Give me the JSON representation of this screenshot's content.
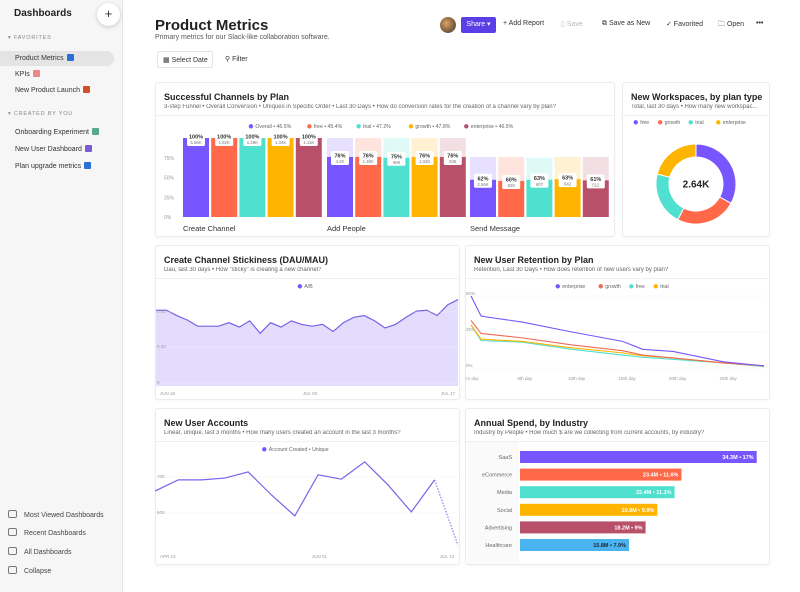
{
  "sidebar": {
    "title": "Dashboards",
    "add_label": "+",
    "favorites_label": "FAVORITES",
    "created_label": "CREATED BY YOU",
    "favorites": [
      {
        "label": "Product Metrics",
        "icon": "blue-square-emoji",
        "color": "#2a6fd6",
        "active": true
      },
      {
        "label": "KPIs",
        "icon": "chart-emoji",
        "color": "#e88"
      },
      {
        "label": "New Product Launch",
        "icon": "sparkle-emoji",
        "color": "#d0502c"
      }
    ],
    "created": [
      {
        "label": "Onboarding Experiment",
        "icon": "pencil-emoji",
        "color": "#5a8"
      },
      {
        "label": "New User Dashboard",
        "icon": "purple-circle-emoji",
        "color": "#7b5ad6"
      },
      {
        "label": "Plan upgrade metrics",
        "icon": "info-emoji",
        "color": "#2a6fd6"
      }
    ],
    "bottom": [
      {
        "label": "Most Viewed Dashboards",
        "icon": "clock-icon"
      },
      {
        "label": "Recent Dashboards",
        "icon": "calendar-icon"
      },
      {
        "label": "All Dashboards",
        "icon": "folder-icon"
      },
      {
        "label": "Collapse",
        "icon": "collapse-icon"
      }
    ]
  },
  "header": {
    "title": "Product Metrics",
    "subtitle": "Primary metrics for our Slack-like collaboration software.",
    "share": "Share ▾",
    "add_report": "+ Add Report",
    "save": "Save",
    "save_as_new": "Save as New",
    "favorited": "✓ Favorited",
    "open": "Open",
    "more": "•••",
    "select_date": "Select Date",
    "filter": "Filter"
  },
  "colors": {
    "purple": "#7856ff",
    "orange": "#ff6848",
    "teal": "#4fe0d0",
    "yellow": "#ffb400",
    "maroon": "#b8506a",
    "blue": "#4ab4f0",
    "accent": "#5b3fe6"
  },
  "chart_data": [
    {
      "id": "funnel",
      "type": "bar",
      "title": "Successful Channels by Plan",
      "subtitle": "3-step Funnel • Overall Conversion • Uniques in Specific Order • Last 30 Days • How do conversion rates for the creation of a channel vary by plan?",
      "legend": [
        "Overall • 46.5%",
        "free • 45.4%",
        "trial • 47.2%",
        "growth • 47.8%",
        "enterprise • 46.5%"
      ],
      "yticks": [
        "0%",
        "25%",
        "50%",
        "75%"
      ],
      "ylim": [
        0,
        100
      ],
      "steps": [
        {
          "name": "Create Channel",
          "pct": [
            100,
            100,
            100,
            100,
            100
          ],
          "counts": [
            "5.56K",
            "1.82K",
            "1.28K",
            "1.34K",
            "1.11K"
          ]
        },
        {
          "name": "Add People",
          "pct": [
            76,
            76,
            75,
            76,
            76
          ],
          "counts": [
            "4.2K",
            "1.38K",
            "959",
            "1.02K",
            "845"
          ]
        },
        {
          "name": "Send Message",
          "pct": [
            62,
            60,
            63,
            63,
            61
          ],
          "counts": [
            "2.56K",
            "828",
            "607",
            "642",
            "512"
          ]
        }
      ]
    },
    {
      "id": "donut",
      "type": "pie",
      "title": "New Workspaces, by plan type",
      "subtitle": "Total, last 30 days • How many new workspac...",
      "legend": [
        "free",
        "growth",
        "trial",
        "enterprise"
      ],
      "values": [
        33,
        24.5,
        21.5,
        21
      ],
      "center": "2.64K"
    },
    {
      "id": "stickiness",
      "type": "area",
      "title": "Create Channel Stickiness (DAU/MAU)",
      "subtitle": "Dau, last 30 days • How \"sticky\" is creating a new channel?",
      "legend": [
        "A/B"
      ],
      "yticks": [
        "0",
        "0.20",
        "0.40"
      ],
      "ylim": [
        0,
        0.6
      ],
      "xticks": [
        "JUN 18",
        "JUL 03",
        "JUL 17"
      ],
      "values": [
        0.41,
        0.41,
        0.38,
        0.355,
        0.32,
        0.32,
        0.32,
        0.34,
        0.315,
        0.35,
        0.28,
        0.34,
        0.315,
        0.35,
        0.33,
        0.32,
        0.33,
        0.29,
        0.34,
        0.37,
        0.38,
        0.35,
        0.31,
        0.33,
        0.37,
        0.405,
        0.41,
        0.38,
        0.44,
        0.47
      ]
    },
    {
      "id": "retention",
      "type": "line",
      "title": "New User Retention by Plan",
      "subtitle": "Retention, Last 30 Days • How does retention of new users vary by plan?",
      "legend": [
        "enterprise",
        "growth",
        "free",
        "trial"
      ],
      "yticks": [
        "0%",
        "25%",
        "50%"
      ],
      "ylim": [
        0,
        50
      ],
      "xticks": [
        "<1 day",
        "5th day",
        "10th day",
        "15th day",
        "20th day",
        "25th day"
      ],
      "series": [
        {
          "name": "enterprise",
          "points": [
            [
              0,
              50
            ],
            [
              1,
              36
            ],
            [
              5,
              32
            ],
            [
              10,
              25
            ],
            [
              15,
              18.5
            ],
            [
              17,
              13
            ],
            [
              20,
              11.5
            ],
            [
              25,
              4.3
            ],
            [
              29,
              1.5
            ]
          ]
        },
        {
          "name": "growth",
          "points": [
            [
              0,
              33
            ],
            [
              1,
              24
            ],
            [
              5,
              21
            ],
            [
              10,
              16
            ],
            [
              15,
              12
            ],
            [
              17,
              9
            ],
            [
              20,
              7
            ],
            [
              25,
              3.5
            ],
            [
              29,
              1.5
            ]
          ]
        },
        {
          "name": "free",
          "points": [
            [
              0,
              30
            ],
            [
              1,
              19
            ],
            [
              5,
              18
            ],
            [
              10,
              13
            ],
            [
              15,
              9
            ],
            [
              17,
              7.5
            ],
            [
              20,
              6
            ],
            [
              25,
              3.5
            ],
            [
              29,
              1
            ]
          ]
        },
        {
          "name": "trial",
          "points": [
            [
              0,
              30
            ],
            [
              1,
              20
            ],
            [
              5,
              18.5
            ],
            [
              10,
              14
            ],
            [
              15,
              10.5
            ],
            [
              17,
              8.5
            ],
            [
              20,
              7
            ],
            [
              25,
              3.5
            ],
            [
              29,
              1.5
            ]
          ]
        }
      ]
    },
    {
      "id": "accounts",
      "type": "line",
      "title": "New User Accounts",
      "subtitle": "Linear, unique, last 3 months • How many users created an account in the last 3 months?",
      "legend": [
        "Account Created • Unique"
      ],
      "yticks": [
        "600",
        "700"
      ],
      "xticks": [
        "APR 13",
        "JUN 01",
        "JUL 13"
      ],
      "x": [
        "Apr 13",
        "Apr 20",
        "Apr 27",
        "May 04",
        "May 11",
        "May 18",
        "May 25",
        "Jun 01",
        "Jun 08",
        "Jun 15",
        "Jun 22",
        "Jun 29",
        "Jul 06",
        "Jul 13"
      ],
      "values": [
        661,
        692,
        692,
        697,
        714,
        650,
        592,
        706,
        694,
        742,
        678,
        603,
        692,
        511
      ]
    },
    {
      "id": "spend",
      "type": "bar",
      "orientation": "horizontal",
      "title": "Annual Spend, by Industry",
      "subtitle": "Industry by People • How much $ are we collecting from current accounts, by industry?",
      "categories": [
        "SaaS",
        "eCommerce",
        "Media",
        "Social",
        "Advertising",
        "Healthcare"
      ],
      "values": [
        34.3,
        23.4,
        22.4,
        19.9,
        18.2,
        15.8
      ],
      "labels": [
        "34.3M • 17%",
        "23.4M • 11.6%",
        "22.4M • 11.1%",
        "19.9M • 9.9%",
        "18.2M • 9%",
        "15.8M • 7.9%"
      ]
    }
  ]
}
